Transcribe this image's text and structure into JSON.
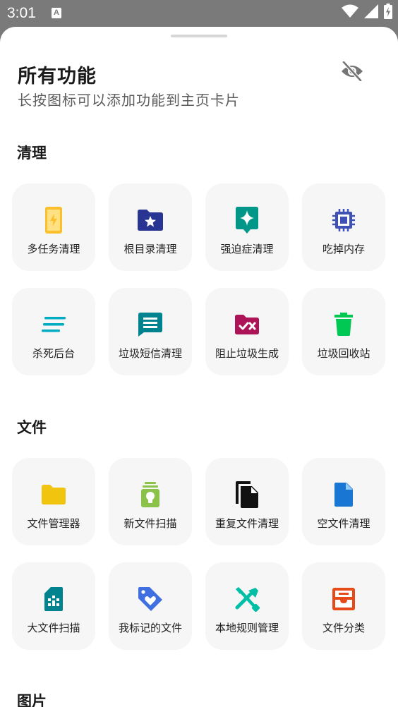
{
  "status_bar": {
    "time": "3:01",
    "notification_letter": "A"
  },
  "header": {
    "title": "所有功能",
    "subtitle": "长按图标可以添加功能到主页卡片"
  },
  "sections": [
    {
      "title": "清理",
      "items": [
        {
          "label": "多任务清理",
          "icon": "phone-charging-icon",
          "color": "#FBC02D"
        },
        {
          "label": "根目录清理",
          "icon": "folder-star-icon",
          "color": "#283593"
        },
        {
          "label": "强迫症清理",
          "icon": "sparkle-badge-icon",
          "color": "#009688"
        },
        {
          "label": "吃掉内存",
          "icon": "chip-icon",
          "color": "#3F51B5"
        },
        {
          "label": "杀死后台",
          "icon": "lines-icon",
          "color": "#00ACC1"
        },
        {
          "label": "垃圾短信清理",
          "icon": "message-icon",
          "color": "#00838F"
        },
        {
          "label": "阻止垃圾生成",
          "icon": "folder-block-icon",
          "color": "#AD1457"
        },
        {
          "label": "垃圾回收站",
          "icon": "trash-icon",
          "color": "#00C853"
        }
      ]
    },
    {
      "title": "文件",
      "items": [
        {
          "label": "文件管理器",
          "icon": "folder-icon",
          "color": "#F1C40F"
        },
        {
          "label": "新文件扫描",
          "icon": "bulb-stack-icon",
          "color": "#8BC34A"
        },
        {
          "label": "重复文件清理",
          "icon": "copy-file-icon",
          "color": "#111111"
        },
        {
          "label": "空文件清理",
          "icon": "file-icon",
          "color": "#1976D2"
        },
        {
          "label": "大文件扫描",
          "icon": "sd-card-icon",
          "color": "#00838F"
        },
        {
          "label": "我标记的文件",
          "icon": "tag-heart-icon",
          "color": "#3F6FE0"
        },
        {
          "label": "本地规则管理",
          "icon": "tools-icon",
          "color": "#00BFA5"
        },
        {
          "label": "文件分类",
          "icon": "inbox-tray-icon",
          "color": "#E64A19"
        }
      ]
    },
    {
      "title": "图片",
      "items": []
    }
  ]
}
